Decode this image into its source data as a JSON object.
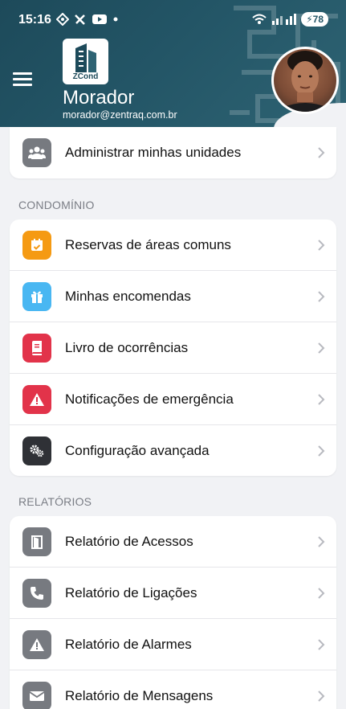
{
  "status_bar": {
    "time": "15:16",
    "battery": "78"
  },
  "header": {
    "title": "Morador",
    "email": "morador@zentraq.com.br",
    "logo_text": "ZCond"
  },
  "top_items": [
    {
      "label": "Administrar minhas unidades",
      "icon": "users-icon",
      "color": "#777a80"
    }
  ],
  "condominio": {
    "title": "CONDOMÍNIO",
    "items": [
      {
        "label": "Reservas de áreas comuns",
        "icon": "calendar-check-icon",
        "color": "#f59a13"
      },
      {
        "label": "Minhas encomendas",
        "icon": "gift-icon",
        "color": "#49b7f2"
      },
      {
        "label": "Livro de ocorrências",
        "icon": "book-icon",
        "color": "#e2334a"
      },
      {
        "label": "Notificações de emergência",
        "icon": "warning-icon",
        "color": "#e2334a"
      },
      {
        "label": "Configuração avançada",
        "icon": "gears-icon",
        "color": "#2f3136"
      }
    ]
  },
  "relatorios": {
    "title": "RELATÓRIOS",
    "items": [
      {
        "label": "Relatório de Acessos",
        "icon": "door-icon",
        "color": "#777a80"
      },
      {
        "label": "Relatório de Ligações",
        "icon": "phone-icon",
        "color": "#777a80"
      },
      {
        "label": "Relatório de Alarmes",
        "icon": "warning-icon",
        "color": "#777a80"
      },
      {
        "label": "Relatório de Mensagens",
        "icon": "envelope-icon",
        "color": "#777a80"
      }
    ]
  }
}
